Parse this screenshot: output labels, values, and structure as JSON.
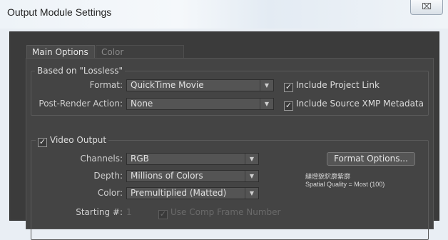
{
  "window": {
    "title": "Output Module Settings",
    "close_glyph": "⌧"
  },
  "tabs": [
    {
      "label": "Main Options",
      "active": true
    },
    {
      "label": "Color Management",
      "active": false
    }
  ],
  "based_on": {
    "label": "Based on \"Lossless\"",
    "format_label": "Format:",
    "format_value": "QuickTime Movie",
    "post_render_label": "Post-Render Action:",
    "post_render_value": "None",
    "include_project_link": {
      "label": "Include Project Link",
      "checked": true
    },
    "include_xmp": {
      "label": "Include Source XMP Metadata",
      "checked": true
    }
  },
  "video_output": {
    "label": "Video Output",
    "checked": true,
    "channels_label": "Channels:",
    "channels_value": "RGB",
    "depth_label": "Depth:",
    "depth_value": "Millions of Colors",
    "color_label": "Color:",
    "color_value": "Premultiplied (Matted)",
    "format_options_label": "Format Options...",
    "info_line1": "縺燈貌貁廓紫廓",
    "info_line2": "Spatial Quality = Most (100)",
    "starting_label": "Starting #:",
    "starting_value": "1",
    "use_comp_frame": {
      "label": "Use Comp Frame Number",
      "checked": true
    }
  },
  "colors": {
    "panel": "#3b3b3b",
    "tab_body": "#444444",
    "field": "#545454"
  }
}
